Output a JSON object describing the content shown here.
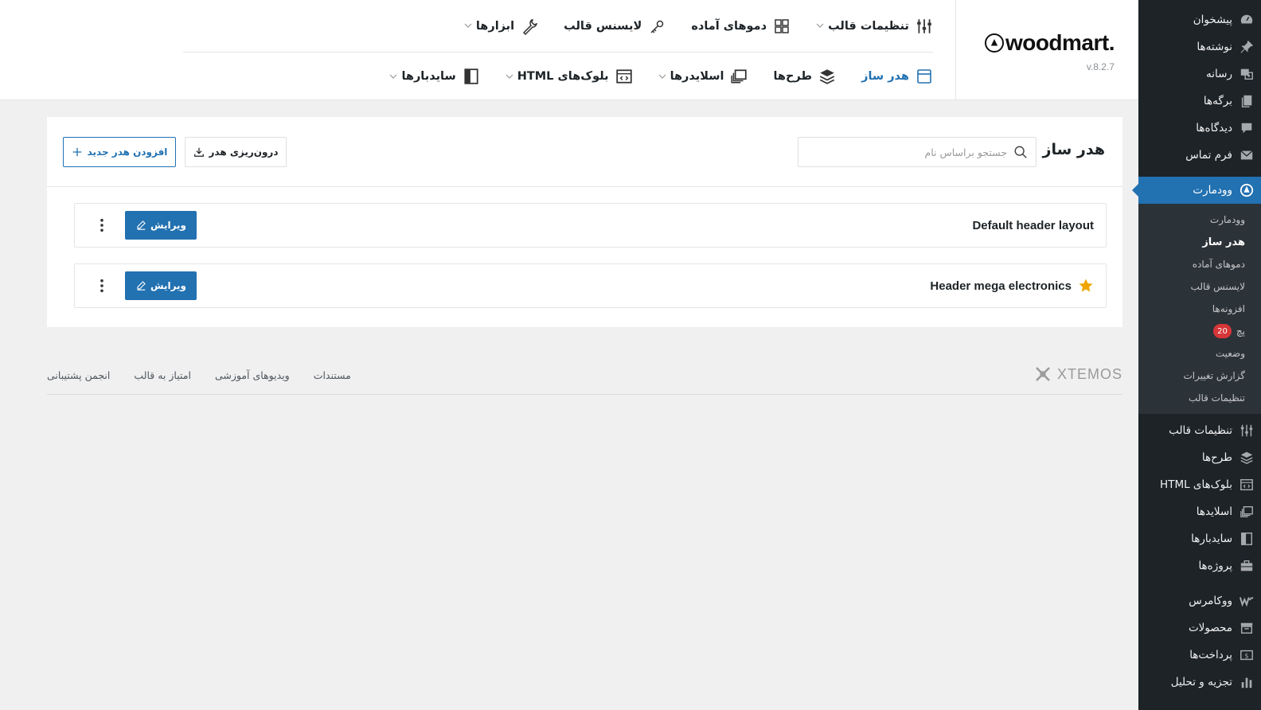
{
  "sidebar": {
    "top_items": [
      {
        "label": "پیشخوان",
        "icon": "dashboard-icon"
      },
      {
        "label": "نوشته‌ها",
        "icon": "pin-icon"
      },
      {
        "label": "رسانه",
        "icon": "media-icon"
      },
      {
        "label": "برگه‌ها",
        "icon": "pages-icon"
      },
      {
        "label": "دیدگاه‌ها",
        "icon": "comments-icon"
      },
      {
        "label": "فرم تماس",
        "icon": "mail-icon"
      }
    ],
    "active_item": {
      "label": "وودمارت",
      "icon": "woodmart-icon"
    },
    "submenu": [
      {
        "label": "وودمارت"
      },
      {
        "label": "هدر ساز",
        "current": true
      },
      {
        "label": "دموهای آماده"
      },
      {
        "label": "لایسنس قالب"
      },
      {
        "label": "افزونه‌ها"
      },
      {
        "label": "پچ",
        "badge": "20"
      },
      {
        "label": "وضعیت"
      },
      {
        "label": "گزارش تغییرات"
      },
      {
        "label": "تنظیمات قالب"
      }
    ],
    "bottom_items": [
      {
        "label": "تنظیمات قالب",
        "icon": "sliders-icon"
      },
      {
        "label": "طرح‌ها",
        "icon": "layers-icon"
      },
      {
        "label": "بلوک‌های HTML",
        "icon": "html-block-icon"
      },
      {
        "label": "اسلایدها",
        "icon": "slides-icon"
      },
      {
        "label": "سایدبارها",
        "icon": "sidebar-icon"
      },
      {
        "label": "پروژه‌ها",
        "icon": "briefcase-icon"
      },
      {
        "label": "ووکامرس",
        "icon": "woocommerce-icon"
      },
      {
        "label": "محصولات",
        "icon": "archive-icon"
      },
      {
        "label": "پرداخت‌ها",
        "icon": "payments-icon"
      },
      {
        "label": "تجزیه و تحلیل",
        "icon": "analytics-icon"
      }
    ]
  },
  "brand": {
    "logo_text": "woodmart.",
    "version": "v.8.2.7"
  },
  "topnav": {
    "row1": [
      {
        "label": "تنظیمات قالب",
        "icon": "sliders-icon",
        "dropdown": true
      },
      {
        "label": "دموهای آماده",
        "icon": "grid-icon",
        "dropdown": false
      },
      {
        "label": "لایسنس قالب",
        "icon": "key-icon",
        "dropdown": false
      },
      {
        "label": "ابزارها",
        "icon": "wrench-icon",
        "dropdown": true
      }
    ],
    "row2": [
      {
        "label": "هدر ساز",
        "icon": "header-icon",
        "dropdown": false,
        "active": true
      },
      {
        "label": "طرح‌ها",
        "icon": "layers-icon",
        "dropdown": false
      },
      {
        "label": "اسلایدرها",
        "icon": "slides-icon",
        "dropdown": true
      },
      {
        "label": "بلوک‌های HTML",
        "icon": "html-block-icon",
        "dropdown": true
      },
      {
        "label": "سایدبارها",
        "icon": "sidebar-icon",
        "dropdown": true
      }
    ]
  },
  "card": {
    "title": "هدر ساز",
    "search_placeholder": "جستجو براساس نام",
    "import_label": "درون‌ریزی هدر",
    "add_label": "افزودن هدر جدید",
    "headers": [
      {
        "name": "Default header layout",
        "starred": false,
        "edit_label": "ویرایش"
      },
      {
        "name": "Header mega electronics",
        "starred": true,
        "edit_label": "ویرایش"
      }
    ]
  },
  "footer": {
    "brand": "XTEMOS",
    "links": [
      "مستندات",
      "ویدیوهای آموزشی",
      "امتیاز به قالب",
      "انجمن پشتیبانی"
    ]
  },
  "colors": {
    "accent": "#2271b1",
    "sidebar_bg": "#1d2327",
    "star": "#f0a500",
    "badge": "#d63638"
  }
}
